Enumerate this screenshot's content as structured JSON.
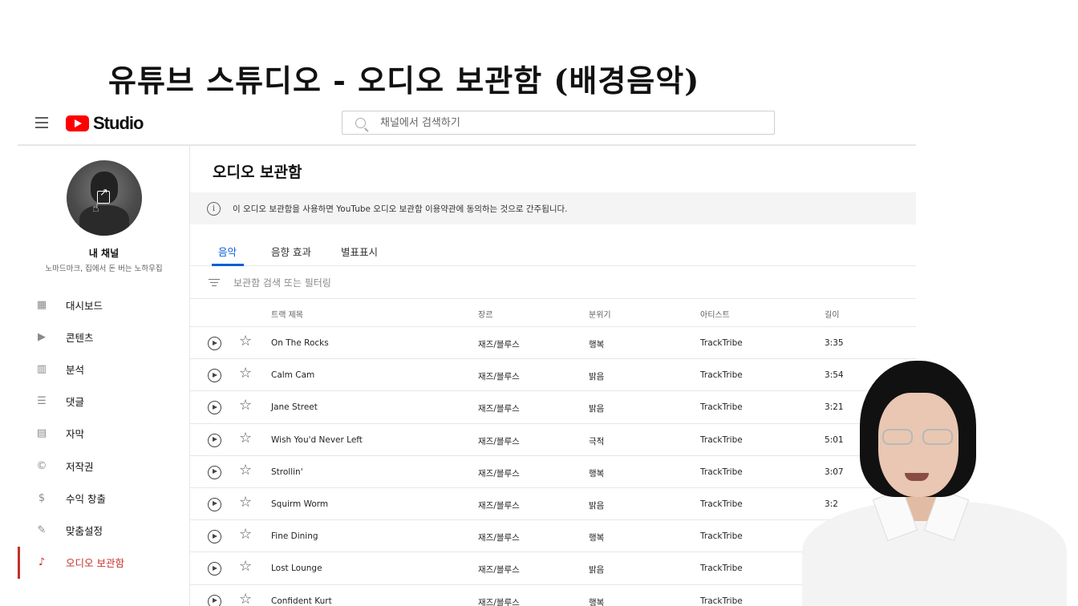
{
  "video_title": "유튜브 스튜디오 - 오디오 보관함 (배경음악)",
  "header": {
    "logo_text": "Studio",
    "search_placeholder": "채널에서 검색하기"
  },
  "sidebar": {
    "channel_name": "내 채널",
    "channel_subtitle": "노마드마크, 집에서 돈 버는 노하우집",
    "items": [
      {
        "label": "대시보드",
        "icon": "dashboard-icon",
        "glyph": "▦"
      },
      {
        "label": "콘텐츠",
        "icon": "content-icon",
        "glyph": "▶"
      },
      {
        "label": "분석",
        "icon": "analytics-icon",
        "glyph": "▥"
      },
      {
        "label": "댓글",
        "icon": "comments-icon",
        "glyph": "☰"
      },
      {
        "label": "자막",
        "icon": "subtitles-icon",
        "glyph": "▤"
      },
      {
        "label": "저작권",
        "icon": "copyright-icon",
        "glyph": "©"
      },
      {
        "label": "수익 창출",
        "icon": "monetization-icon",
        "glyph": "$"
      },
      {
        "label": "맞춤설정",
        "icon": "customization-icon",
        "glyph": "✎"
      },
      {
        "label": "오디오 보관함",
        "icon": "audio-library-icon",
        "glyph": "♪"
      }
    ],
    "active_index": 8,
    "accent_color": "#c4302b"
  },
  "main": {
    "title": "오디오 보관함",
    "notice": "이 오디오 보관함을 사용하면 YouTube 오디오 보관함 이용약관에 동의하는 것으로 간주됩니다.",
    "tabs": [
      "음악",
      "음향 효과",
      "별표표시"
    ],
    "active_tab": 0,
    "filter_placeholder": "보관함 검색 또는 필터링",
    "columns": [
      "트랙 제목",
      "장르",
      "분위기",
      "아티스트",
      "길이"
    ],
    "tracks": [
      {
        "title": "On The Rocks",
        "genre": "재즈/블루스",
        "mood": "행복",
        "artist": "TrackTribe",
        "length": "3:35"
      },
      {
        "title": "Calm Cam",
        "genre": "재즈/블루스",
        "mood": "밝음",
        "artist": "TrackTribe",
        "length": "3:54"
      },
      {
        "title": "Jane Street",
        "genre": "재즈/블루스",
        "mood": "밝음",
        "artist": "TrackTribe",
        "length": "3:21"
      },
      {
        "title": "Wish You'd Never Left",
        "genre": "재즈/블루스",
        "mood": "극적",
        "artist": "TrackTribe",
        "length": "5:01"
      },
      {
        "title": "Strollin'",
        "genre": "재즈/블루스",
        "mood": "행복",
        "artist": "TrackTribe",
        "length": "3:07"
      },
      {
        "title": "Squirm Worm",
        "genre": "재즈/블루스",
        "mood": "밝음",
        "artist": "TrackTribe",
        "length": "3:2"
      },
      {
        "title": "Fine Dining",
        "genre": "재즈/블루스",
        "mood": "행복",
        "artist": "TrackTribe",
        "length": ""
      },
      {
        "title": "Lost Lounge",
        "genre": "재즈/블루스",
        "mood": "밝음",
        "artist": "TrackTribe",
        "length": ""
      },
      {
        "title": "Confident Kurt",
        "genre": "재즈/블루스",
        "mood": "행복",
        "artist": "TrackTribe",
        "length": ""
      }
    ]
  }
}
